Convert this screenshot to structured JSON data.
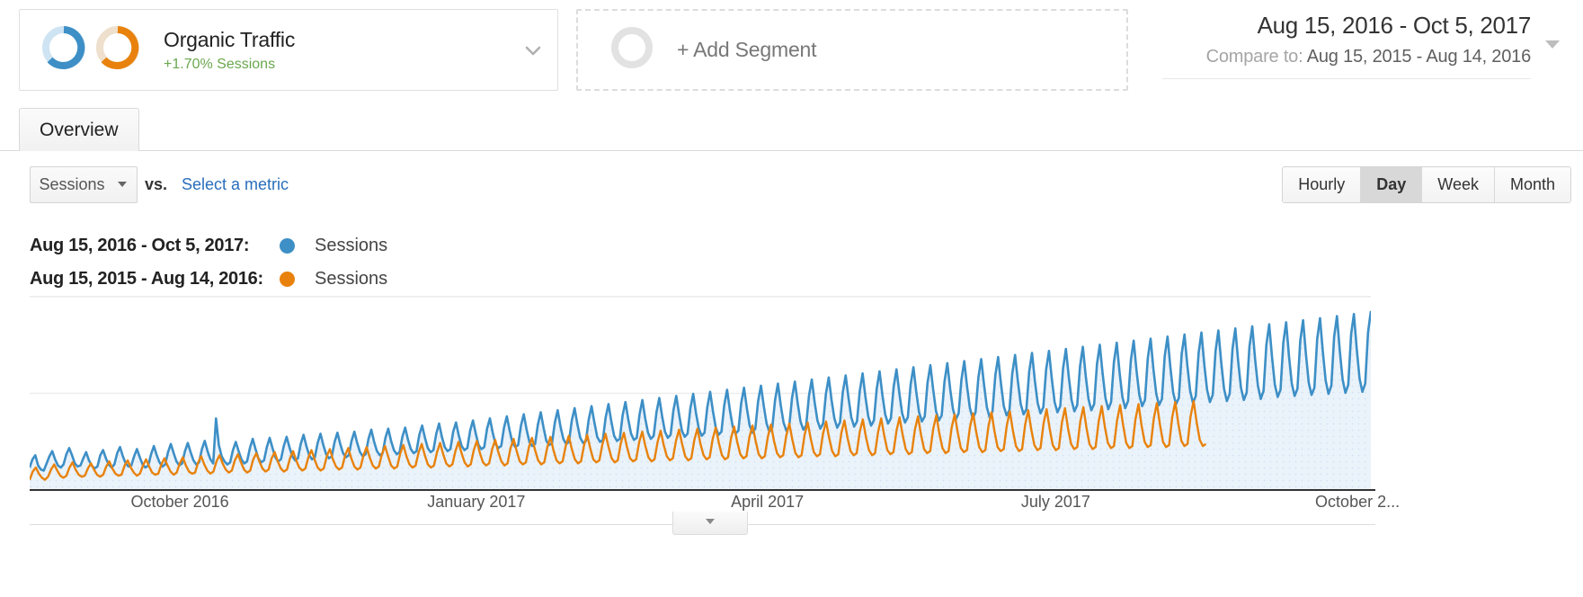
{
  "segment": {
    "name": "Organic Traffic",
    "delta": "+1.70% Sessions",
    "delta_color": "#6aa84f",
    "caret_icon": "chevron-down-icon",
    "donut_blue_icon": "donut-blue-icon",
    "donut_orange_icon": "donut-orange-icon"
  },
  "add_segment": {
    "label": "+ Add Segment",
    "ring_icon": "donut-empty-icon"
  },
  "date_range": {
    "primary": "Aug 15, 2016 - Oct 5, 2017",
    "compare_label": "Compare to:",
    "compare_value": "Aug 15, 2015 - Aug 14, 2016",
    "caret_icon": "triangle-down-icon"
  },
  "tabs": [
    {
      "label": "Overview",
      "active": true
    }
  ],
  "controls": {
    "metric_select": "Sessions",
    "metric_select_caret_icon": "triangle-down-icon",
    "vs_label": "vs.",
    "select_metric_link": "Select a metric",
    "granularity": [
      {
        "label": "Hourly",
        "active": false
      },
      {
        "label": "Day",
        "active": true
      },
      {
        "label": "Week",
        "active": false
      },
      {
        "label": "Month",
        "active": false
      }
    ]
  },
  "legend": [
    {
      "range": "Aug 15, 2016 - Oct 5, 2017:",
      "metric": "Sessions",
      "color": "#3d8fc6"
    },
    {
      "range": "Aug 15, 2015 - Aug 14, 2016:",
      "metric": "Sessions",
      "color": "#e8820c"
    }
  ],
  "collapse_handle_icon": "triangle-down-icon",
  "chart_data": {
    "type": "line",
    "title": "Sessions over time",
    "xlabel": "",
    "ylabel": "Sessions",
    "grid": true,
    "gridlines_y": [
      0.5,
      1.0
    ],
    "legend_position": "above",
    "axis_color": "#333333",
    "x_tick_labels": [
      "October 2016",
      "January 2017",
      "April 2017",
      "July 2017",
      "October 2..."
    ],
    "x_tick_positions_pct": [
      11.2,
      33.3,
      55.0,
      76.5,
      99.0
    ],
    "series": [
      {
        "name": "Sessions",
        "range": "Aug 15, 2016 - Oct 5, 2017",
        "color": "#3d8fc6",
        "fill": "#eaf2fa",
        "values": [
          22,
          30,
          34,
          24,
          20,
          19,
          26,
          33,
          38,
          30,
          24,
          22,
          25,
          35,
          41,
          34,
          26,
          23,
          24,
          31,
          37,
          29,
          24,
          21,
          23,
          34,
          39,
          31,
          25,
          22,
          25,
          36,
          42,
          33,
          26,
          23,
          24,
          33,
          40,
          32,
          25,
          22,
          24,
          35,
          43,
          34,
          27,
          23,
          25,
          37,
          45,
          36,
          28,
          24,
          26,
          38,
          46,
          37,
          29,
          25,
          27,
          40,
          48,
          38,
          30,
          26,
          70,
          44,
          33,
          28,
          25,
          27,
          39,
          47,
          38,
          30,
          26,
          28,
          41,
          50,
          40,
          31,
          27,
          29,
          42,
          51,
          41,
          32,
          28,
          30,
          43,
          52,
          42,
          33,
          29,
          31,
          45,
          54,
          43,
          34,
          30,
          32,
          46,
          55,
          44,
          35,
          31,
          33,
          47,
          56,
          45,
          36,
          32,
          34,
          48,
          57,
          46,
          37,
          33,
          35,
          50,
          59,
          47,
          38,
          34,
          36,
          51,
          60,
          48,
          39,
          35,
          37,
          52,
          61,
          49,
          40,
          36,
          38,
          54,
          63,
          51,
          41,
          37,
          39,
          55,
          65,
          52,
          42,
          38,
          40,
          57,
          66,
          53,
          43,
          39,
          41,
          58,
          68,
          55,
          44,
          40,
          42,
          60,
          70,
          56,
          45,
          41,
          43,
          61,
          72,
          58,
          46,
          42,
          44,
          63,
          74,
          59,
          47,
          43,
          45,
          64,
          76,
          61,
          48,
          44,
          46,
          66,
          78,
          62,
          50,
          45,
          47,
          68,
          80,
          64,
          51,
          46,
          48,
          69,
          82,
          66,
          52,
          47,
          49,
          71,
          84,
          67,
          53,
          48,
          50,
          73,
          86,
          69,
          55,
          49,
          51,
          74,
          88,
          70,
          56,
          50,
          53,
          76,
          90,
          72,
          57,
          51,
          54,
          78,
          92,
          74,
          58,
          52,
          55,
          80,
          94,
          75,
          60,
          53,
          56,
          81,
          96,
          77,
          61,
          54,
          57,
          83,
          98,
          78,
          62,
          55,
          58,
          85,
          100,
          80,
          63,
          56,
          60,
          87,
          102,
          82,
          65,
          57,
          61,
          88,
          104,
          83,
          66,
          58,
          62,
          90,
          106,
          85,
          67,
          59,
          63,
          92,
          108,
          86,
          68,
          60,
          65,
          94,
          110,
          88,
          70,
          61,
          66,
          96,
          112,
          90,
          71,
          62,
          67,
          97,
          114,
          91,
          72,
          63,
          68,
          99,
          116,
          93,
          74,
          65,
          70,
          101,
          118,
          95,
          75,
          66,
          71,
          103,
          120,
          96,
          76,
          67,
          72,
          105,
          122,
          98,
          77,
          68,
          73,
          106,
          124,
          99,
          79,
          69,
          75,
          108,
          126,
          101,
          80,
          70,
          76,
          110,
          128,
          103,
          81,
          71,
          77,
          112,
          130,
          104,
          82,
          73,
          78,
          114,
          132,
          106,
          84,
          74,
          79,
          116,
          134,
          107,
          85,
          75,
          81,
          118,
          136,
          109,
          86,
          76,
          82,
          119,
          138,
          111,
          88,
          77,
          83,
          121,
          140,
          112,
          89,
          78,
          84,
          123,
          142,
          114,
          90,
          79,
          86,
          125,
          144,
          115,
          91,
          80,
          87,
          127,
          146,
          117,
          93,
          82,
          88,
          129,
          148,
          118,
          94,
          83,
          89,
          131,
          150,
          120,
          95,
          84,
          90,
          133,
          152,
          122,
          97,
          85,
          92,
          134,
          154,
          123,
          98,
          86,
          93,
          136,
          156,
          125,
          99,
          87,
          94,
          138,
          158,
          126,
          100,
          88,
          95,
          140,
          160,
          128,
          102,
          89,
          97,
          142,
          162,
          130,
          103,
          91,
          98,
          144,
          164,
          131,
          104,
          92,
          99,
          146,
          166,
          133,
          105,
          93,
          100,
          148,
          168,
          135,
          107,
          94,
          102,
          150,
          170,
          136,
          108,
          95,
          103,
          152,
          172,
          138,
          109,
          96,
          104,
          154,
          175
        ]
      },
      {
        "name": "Sessions",
        "range": "Aug 15, 2015 - Aug 14, 2016",
        "color": "#e8820c",
        "fill": "none",
        "values": [
          10,
          18,
          22,
          16,
          12,
          10,
          13,
          20,
          25,
          19,
          14,
          12,
          14,
          22,
          27,
          20,
          15,
          13,
          14,
          21,
          26,
          20,
          15,
          13,
          15,
          23,
          28,
          21,
          16,
          14,
          15,
          24,
          29,
          22,
          17,
          14,
          16,
          24,
          30,
          23,
          17,
          15,
          16,
          25,
          31,
          24,
          18,
          15,
          17,
          26,
          32,
          24,
          18,
          16,
          17,
          27,
          33,
          25,
          19,
          16,
          18,
          28,
          34,
          26,
          20,
          17,
          19,
          29,
          35,
          27,
          20,
          17,
          19,
          30,
          36,
          28,
          21,
          18,
          20,
          31,
          37,
          28,
          21,
          18,
          20,
          31,
          38,
          29,
          22,
          19,
          21,
          32,
          39,
          30,
          22,
          19,
          21,
          33,
          40,
          30,
          23,
          20,
          22,
          34,
          41,
          31,
          23,
          20,
          22,
          34,
          42,
          32,
          24,
          21,
          23,
          35,
          43,
          33,
          24,
          21,
          23,
          36,
          44,
          33,
          25,
          22,
          24,
          37,
          45,
          34,
          25,
          22,
          24,
          37,
          46,
          35,
          26,
          23,
          25,
          38,
          47,
          36,
          27,
          23,
          25,
          39,
          48,
          36,
          27,
          24,
          26,
          40,
          49,
          37,
          28,
          24,
          26,
          41,
          50,
          38,
          28,
          25,
          27,
          42,
          51,
          39,
          29,
          25,
          27,
          42,
          52,
          39,
          29,
          26,
          28,
          43,
          53,
          40,
          30,
          26,
          28,
          44,
          54,
          41,
          30,
          27,
          29,
          45,
          55,
          42,
          31,
          27,
          29,
          46,
          56,
          42,
          31,
          28,
          30,
          47,
          57,
          43,
          32,
          28,
          30,
          47,
          58,
          44,
          33,
          29,
          31,
          48,
          59,
          45,
          33,
          29,
          31,
          49,
          60,
          45,
          34,
          30,
          32,
          50,
          61,
          46,
          34,
          30,
          32,
          51,
          62,
          47,
          35,
          31,
          33,
          52,
          63,
          48,
          35,
          31,
          33,
          52,
          64,
          48,
          36,
          32,
          34,
          53,
          65,
          49,
          36,
          32,
          34,
          54,
          66,
          50,
          37,
          33,
          35,
          55,
          67,
          51,
          38,
          33,
          35,
          56,
          68,
          51,
          38,
          34,
          36,
          57,
          69,
          52,
          39,
          34,
          36,
          57,
          70,
          53,
          39,
          35,
          37,
          58,
          71,
          54,
          40,
          35,
          37,
          59,
          72,
          54,
          40,
          36,
          38,
          60,
          73,
          55,
          41,
          36,
          38,
          61,
          74,
          56,
          41,
          37,
          39,
          62,
          75,
          57,
          42,
          37,
          39,
          62,
          76,
          57,
          42,
          38,
          40,
          63,
          77,
          58,
          43,
          38,
          40,
          64,
          78,
          59,
          44,
          39,
          41,
          65,
          79,
          60,
          44,
          39,
          41,
          66,
          80,
          60,
          45,
          40,
          42,
          67,
          81,
          61,
          45,
          40,
          42,
          67,
          82,
          62,
          46,
          41,
          43,
          68,
          83,
          63,
          46,
          41,
          43,
          69,
          84,
          63,
          47,
          42,
          44,
          70,
          85,
          64,
          47,
          42,
          44,
          71,
          86,
          65,
          48,
          43,
          45,
          72,
          87,
          66,
          49,
          43,
          45
        ]
      }
    ]
  }
}
